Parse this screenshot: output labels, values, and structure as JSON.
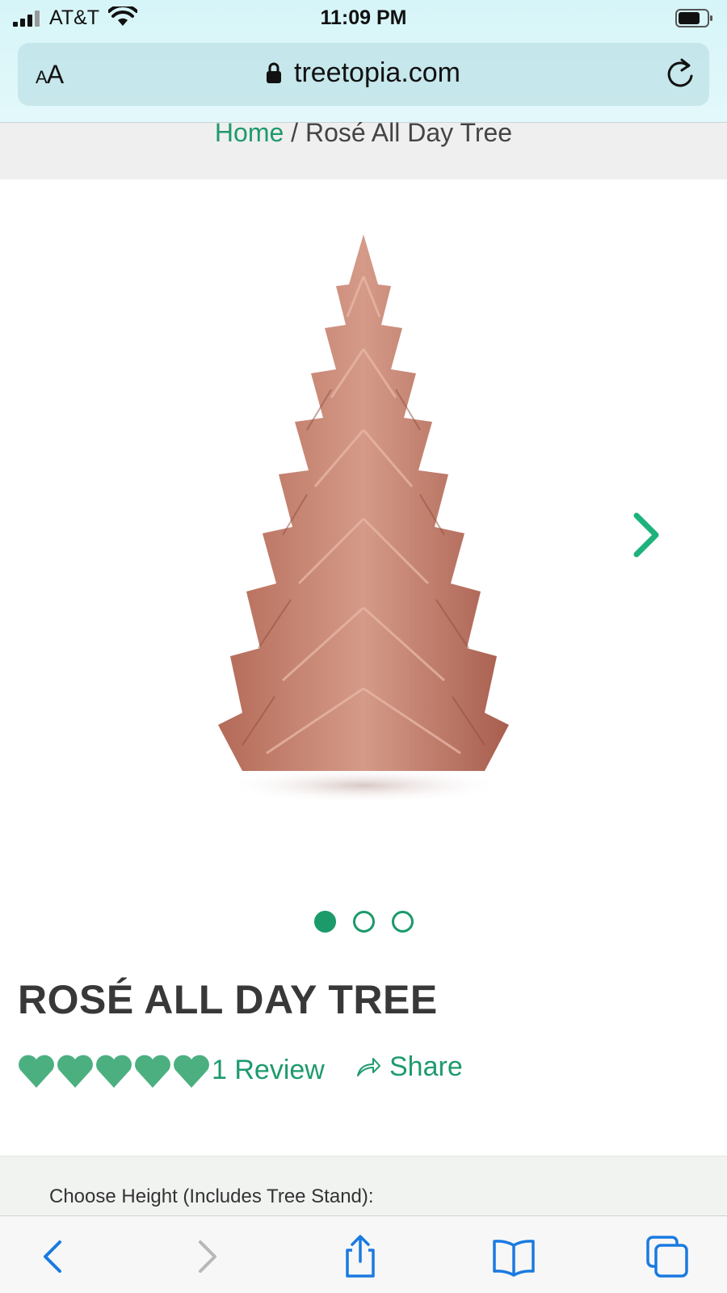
{
  "status_bar": {
    "carrier": "AT&T",
    "time": "11:09 PM"
  },
  "browser": {
    "text_size_button": "AA",
    "url": "treetopia.com"
  },
  "breadcrumb": {
    "home": "Home",
    "separator": "/",
    "current": "Rosé All Day Tree"
  },
  "gallery": {
    "image_count": 3,
    "active_index": 0
  },
  "product": {
    "title": "ROSÉ ALL DAY TREE",
    "rating_hearts": 5,
    "reviews_label": "1 Review",
    "share_label": "Share"
  },
  "options": {
    "height_label": "Choose Height (Includes Tree Stand):"
  },
  "colors": {
    "accent_green": "#1e9a6d",
    "heart_green": "#4caf80",
    "tree_rose": "#c98270",
    "ios_blue": "#1a7ae0"
  },
  "toolbar": {
    "icons": [
      "back-icon",
      "forward-icon",
      "share-icon",
      "bookmarks-icon",
      "tabs-icon"
    ]
  }
}
